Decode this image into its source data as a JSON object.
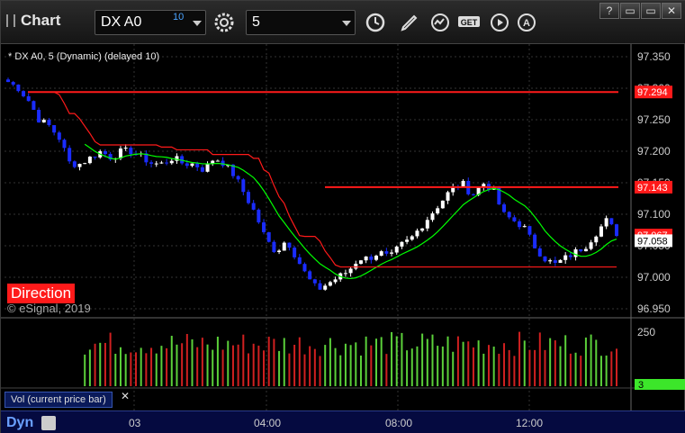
{
  "window": {
    "title": "Chart"
  },
  "toolbar": {
    "symbol": "DX A0",
    "symbol_delay": "10",
    "interval": "5",
    "icons": [
      "settings-icon",
      "clock-icon",
      "pencil-icon",
      "study-icon",
      "get-icon",
      "play-icon",
      "auto-icon"
    ],
    "window_buttons": [
      "?",
      "▭",
      "▭",
      "✕"
    ]
  },
  "legend": "* DX A0, 5 (Dynamic) (delayed 10)",
  "direction_label": "Direction",
  "copyright": "© eSignal, 2019",
  "volume_pane": {
    "label": "Vol (current price bar)",
    "ytick": "250",
    "current": "3"
  },
  "price_axis": {
    "ticks": [
      "97.350",
      "97.300",
      "97.250",
      "97.200",
      "97.150",
      "97.100",
      "97.050",
      "97.000",
      "96.950"
    ],
    "tags": [
      {
        "label": "97.294",
        "color": "#ff1a1a"
      },
      {
        "label": "97.143",
        "color": "#ff1a1a"
      },
      {
        "label": "97.067",
        "color": "#ff1a1a"
      },
      {
        "label": "97.058",
        "color": "#ffffff"
      }
    ]
  },
  "time_axis": [
    "03",
    "04:00",
    "08:00",
    "12:00"
  ],
  "bottom_bar": {
    "label": "Dyn"
  },
  "colors": {
    "up": "#ffffff",
    "down": "#1a2cff",
    "stop": "#ff1a1a",
    "ma": "#00ff00"
  },
  "chart_data": {
    "type": "candlestick",
    "ylim": [
      96.95,
      97.35
    ],
    "last": 97.058,
    "levels": [
      97.294,
      97.143
    ],
    "close_path": [
      97.31,
      97.3,
      97.28,
      97.25,
      97.24,
      97.22,
      97.18,
      97.18,
      97.19,
      97.2,
      97.19,
      97.2,
      97.2,
      97.19,
      97.18,
      97.18,
      97.19,
      97.18,
      97.18,
      97.17,
      97.19,
      97.18,
      97.16,
      97.13,
      97.1,
      97.06,
      97.04,
      97.06,
      97.03,
      97.0,
      96.98,
      96.99,
      97.0,
      97.01,
      97.03,
      97.03,
      97.04,
      97.03,
      97.05,
      97.06,
      97.08,
      97.1,
      97.12,
      97.14,
      97.15,
      97.13,
      97.15,
      97.14,
      97.1,
      97.09,
      97.08,
      97.05,
      97.03,
      97.02,
      97.03,
      97.04,
      97.05,
      97.07,
      97.09,
      97.07
    ]
  }
}
